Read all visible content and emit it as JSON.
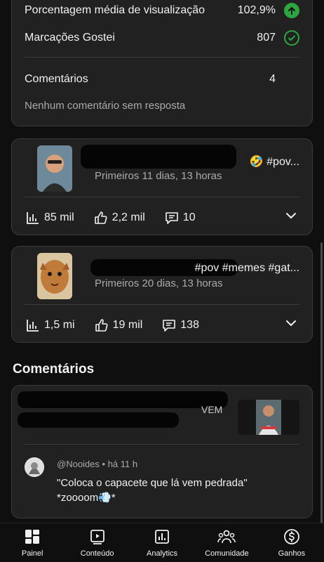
{
  "stats": {
    "avg_view_label": "Porcentagem média de visualização",
    "avg_view_value": "102,9%",
    "likes_label": "Marcações Gostei",
    "likes_value": "807",
    "comments_label": "Comentários",
    "comments_value": "4",
    "no_reply_text": "Nenhum comentário sem resposta"
  },
  "videos": [
    {
      "title_visible": "🤣 #pov...",
      "subtitle": "Primeiros 11 dias, 13 horas",
      "views": "85 mil",
      "likes": "2,2 mil",
      "comments": "10"
    },
    {
      "title_visible": "#pov #memes #gat...",
      "subtitle": "Primeiros 20 dias, 13 horas",
      "views": "1,5 mi",
      "likes": "19 mil",
      "comments": "138"
    }
  ],
  "comments_section": {
    "heading": "Comentários",
    "partial_title": "VEM",
    "author": "@Nooides",
    "time": "há 11 h",
    "text_line1": "\"Coloca o capacete que lá vem pedrada\"",
    "text_line2": "*zoooom💨*"
  },
  "nav": [
    {
      "label": "Painel",
      "icon": "dashboard-icon"
    },
    {
      "label": "Conteúdo",
      "icon": "content-icon"
    },
    {
      "label": "Analytics",
      "icon": "analytics-icon"
    },
    {
      "label": "Comunidade",
      "icon": "community-icon"
    },
    {
      "label": "Ganhos",
      "icon": "earnings-icon"
    }
  ],
  "colors": {
    "up_green": "#2ba640",
    "background": "#0f0f0f",
    "card": "#212121"
  }
}
